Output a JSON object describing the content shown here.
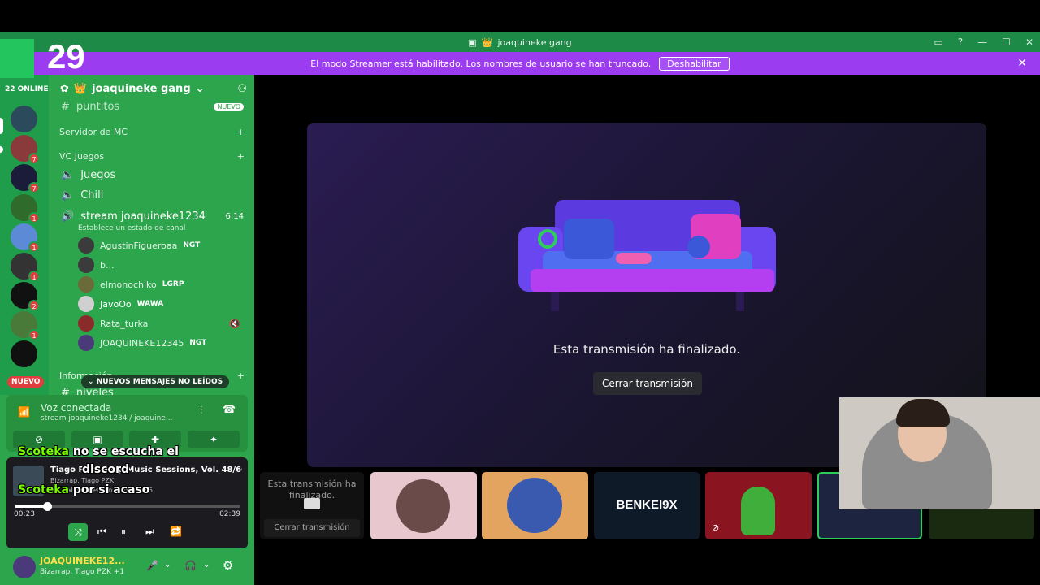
{
  "window": {
    "title": "joaquineke gang"
  },
  "banner": {
    "text": "El modo Streamer está habilitado. Los nombres de usuario se han truncado.",
    "button": "Deshabilitar"
  },
  "overlay": {
    "number": "29"
  },
  "guilds": {
    "online": "22 ONLINE",
    "badges": [
      "7",
      "7",
      "1",
      "1",
      "1",
      "1",
      "2",
      "1"
    ],
    "nuevo": "NUEVO"
  },
  "server": {
    "name": "joaquineke gang"
  },
  "channels": {
    "partial_top": "puntitos",
    "partial_badge": "NUEVO",
    "cat1": "Servidor de MC",
    "cat2": "VC Juegos",
    "ch_juegos": "Juegos",
    "ch_chill": "Chill",
    "ch_stream": "stream joaquineke1234",
    "ch_stream_time": "6:14",
    "ch_status": "Establece un estado de canal",
    "users": [
      {
        "name": "AgustinFigueroaa",
        "tag": "NGT"
      },
      {
        "name": "b...",
        "tag": ""
      },
      {
        "name": "elmonochiko",
        "tag": "LGRP"
      },
      {
        "name": "JavoOo",
        "tag": "WAWA"
      },
      {
        "name": "Rata_turka",
        "tag": ""
      },
      {
        "name": "JOAQUINEKE12345",
        "tag": "NGT"
      }
    ],
    "cat3": "Información",
    "niveles": "niveles",
    "newmsg": "NUEVOS MENSAJES NO LEÍDOS"
  },
  "voice": {
    "status": "Voz conectada",
    "sub": "stream joaquineke1234 / joaquine..."
  },
  "player": {
    "title": "Tiago PZK: Bzrp Music Sessions, Vol. 48/66",
    "artist": "Bizarrap, Tiago PZK",
    "album": "Bzrp Music Sessions, Vol. 48/66",
    "elapsed": "00:23",
    "total": "02:39",
    "progress": 0.145
  },
  "userbar": {
    "name": "JOAQUINEKE12...",
    "status": "Bizarrap, Tiago PZK +1"
  },
  "subtitles": {
    "line1_name": "Scoteka",
    "line1_text": "no se escucha el",
    "line2_text": "discord",
    "line3_name": "Scoteka",
    "line3_text": "por si acaso"
  },
  "stream": {
    "ended": "Esta transmisión ha finalizado.",
    "close": "Cerrar transmisión"
  },
  "tiles": {
    "first_text": "Esta transmisión ha finalizado.",
    "first_close": "Cerrar transmisión",
    "benkei": "BENKEI9X"
  },
  "colors": {
    "discord_green": "#2ca54d",
    "banner_purple": "#9b3cf0",
    "title_green": "#1e8a47"
  }
}
